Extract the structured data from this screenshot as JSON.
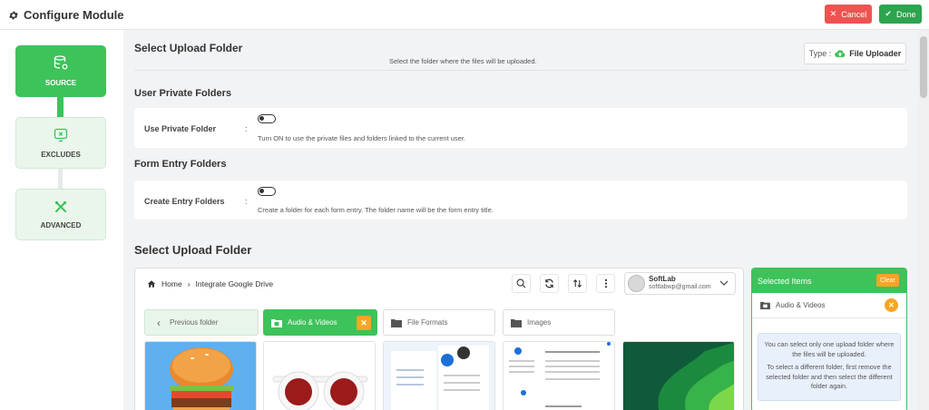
{
  "header": {
    "title": "Configure Module",
    "cancel_label": "Cancel",
    "done_label": "Done"
  },
  "sidebar": {
    "steps": [
      {
        "label": "SOURCE",
        "icon": "database-gear-icon",
        "active": true
      },
      {
        "label": "EXCLUDES",
        "icon": "exclude-icon",
        "active": false
      },
      {
        "label": "ADVANCED",
        "icon": "tools-icon",
        "active": false
      }
    ]
  },
  "main": {
    "section_title": "Select Upload Folder",
    "section_subtitle": "Select the folder where the files will be uploaded.",
    "type_label": "Type :",
    "type_value": "File Uploader",
    "private_heading": "User Private Folders",
    "private_label": "Use Private Folder",
    "private_colon": ":",
    "private_desc": "Turn ON to use the private files and folders linked to the current user.",
    "entry_heading": "Form Entry Folders",
    "entry_label": "Create Entry Folders",
    "entry_colon": ":",
    "entry_desc": "Create a folder for each form entry. The folder name will be the form entry title.",
    "browser_heading": "Select Upload Folder"
  },
  "browser": {
    "breadcrumb_home": "Home",
    "breadcrumb_current": "Integrate Google Drive",
    "account_name": "SoftLab",
    "account_email": "softlabwp@gmail.com",
    "prev_folder": "Previous folder",
    "folders": [
      "Audio & Videos",
      "File Formats",
      "Images"
    ],
    "selected_folder": "Audio & Videos"
  },
  "selected_panel": {
    "title": "Selected Items",
    "clear_label": "Clear",
    "item": "Audio & Videos",
    "note_1": "You can select only one upload folder where the files will be uploaded.",
    "note_2": "To select a different folder, first remove the selected folder and then select the different folder again."
  },
  "colors": {
    "accent": "#3ec25a",
    "danger": "#ef5350",
    "warning": "#f5a623"
  }
}
